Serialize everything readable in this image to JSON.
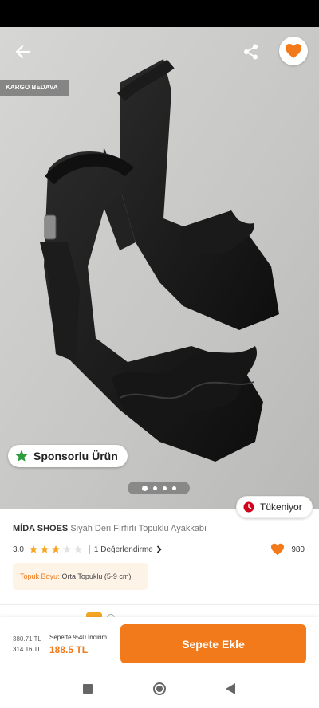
{
  "badges": {
    "cargo": "KARGO BEDAVA",
    "sponsored": "Sponsorlu Ürün",
    "stock": "Tükeniyor"
  },
  "product": {
    "brand": "MİDA SHOES",
    "name": "Siyah Deri Fırfırlı Topuklu Ayakkabı",
    "rating_text": "3.0",
    "rating": 3,
    "rating_max": 5,
    "review_link": "1 Değerlendirme",
    "favorite_count": "980"
  },
  "variant": {
    "key": "Topuk Boyu:",
    "value": "Orta Topuklu (5-9 cm)"
  },
  "gallery": {
    "image_count": 4,
    "active_index": 0
  },
  "pricing": {
    "old_price": "380.71 TL",
    "current_price": "314.16 TL",
    "cart_promo": "Sepette %40 İndirim",
    "cart_price": "188.5 TL"
  },
  "actions": {
    "add_to_cart": "Sepete Ekle"
  },
  "colors": {
    "accent": "#f27a1a",
    "star_filled": "#f6a623",
    "star_empty": "#e2e2e2",
    "sponsor_star": "#2e9b3f",
    "stock_icon": "#d0021b"
  },
  "icons": {
    "back": "arrow-left-icon",
    "share": "share-icon",
    "favorite": "heart-icon",
    "sponsored": "star-icon",
    "stock": "clock-icon",
    "review_chevron": "chevron-right-icon"
  }
}
